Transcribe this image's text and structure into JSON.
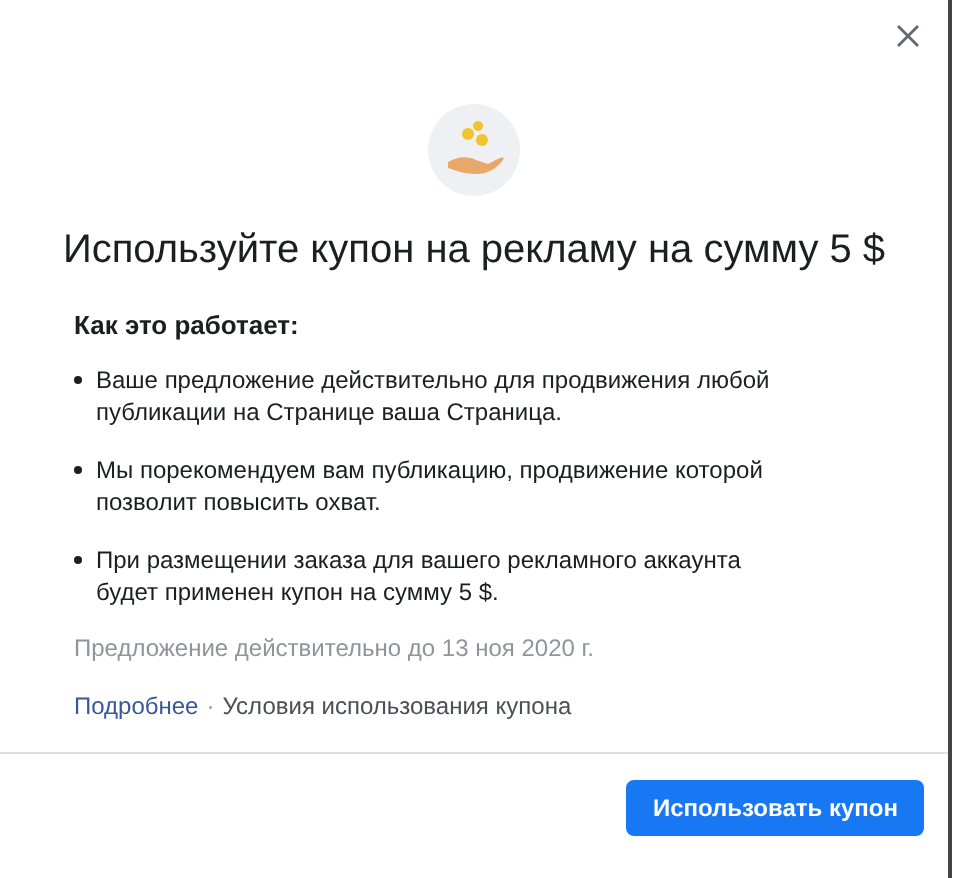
{
  "title": "Используйте купон на рекламу на сумму 5 $",
  "section_heading": "Как это работает:",
  "bullets": [
    "Ваше предложение действительно для продвижения любой публикации на Странице ваша Страница.",
    "Мы порекомендуем вам публикацию, продвижение которой позволит повысить охват.",
    "При размещении заказа для вашего рекламного аккаунта будет применен купон на сумму 5 $."
  ],
  "validity": "Предложение действительно до 13 ноя 2020 г.",
  "links": [
    {
      "label": "Подробнее",
      "kind": "primary"
    },
    {
      "label": "Условия использования купона",
      "kind": "secondary"
    }
  ],
  "separator": "·",
  "button": "Использовать купон"
}
